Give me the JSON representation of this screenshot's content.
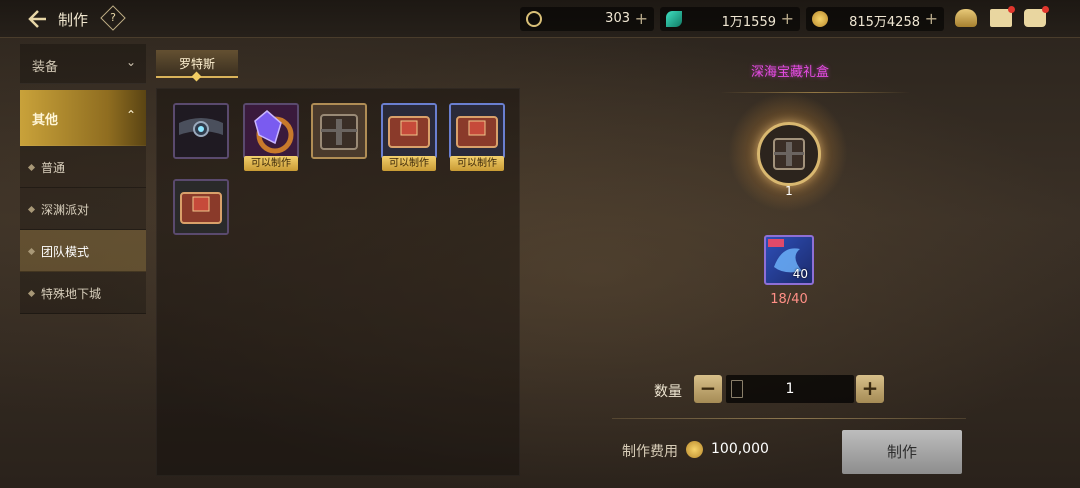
{
  "header": {
    "title": "制作",
    "help_label": "?",
    "currencies": [
      {
        "icon": "credit-coin-icon",
        "value": "303",
        "plus": "+"
      },
      {
        "icon": "green-gem-icon",
        "value": "1万1559",
        "plus": "+"
      },
      {
        "icon": "gold-coin-icon",
        "value": "815万4258",
        "plus": "+"
      }
    ],
    "icons": [
      "bag-icon",
      "mail-icon",
      "chat-icon"
    ]
  },
  "sidebar": {
    "categories": [
      {
        "label": "装备",
        "chevron": "⌄"
      },
      {
        "label": "其他",
        "chevron": "⌃"
      }
    ],
    "subitems": [
      {
        "label": "普通"
      },
      {
        "label": "深渊派对"
      },
      {
        "label": "团队模式"
      },
      {
        "label": "特殊地下城"
      }
    ]
  },
  "tab": {
    "label": "罗特斯"
  },
  "items": [
    {
      "name": "belt",
      "badge": ""
    },
    {
      "name": "ring-gem",
      "badge": "可以制作"
    },
    {
      "name": "treasure-box",
      "badge": ""
    },
    {
      "name": "red-book-box",
      "badge": "可以制作"
    },
    {
      "name": "red-book-box-2",
      "badge": "可以制作"
    },
    {
      "name": "red-book-box-3",
      "badge": ""
    }
  ],
  "recipe": {
    "title": "深海宝藏礼盒",
    "output_count": "1",
    "material_count": "40",
    "material_progress": "18/40"
  },
  "quantity": {
    "label": "数量",
    "value": "1",
    "minus": "−",
    "plus": "+"
  },
  "fee": {
    "label": "制作费用",
    "value": "100,000"
  },
  "craft_button": "制作",
  "colors": {
    "accent": "#d9b35a",
    "title_purple": "#e24be0",
    "deficit_red": "#ff8f86"
  }
}
